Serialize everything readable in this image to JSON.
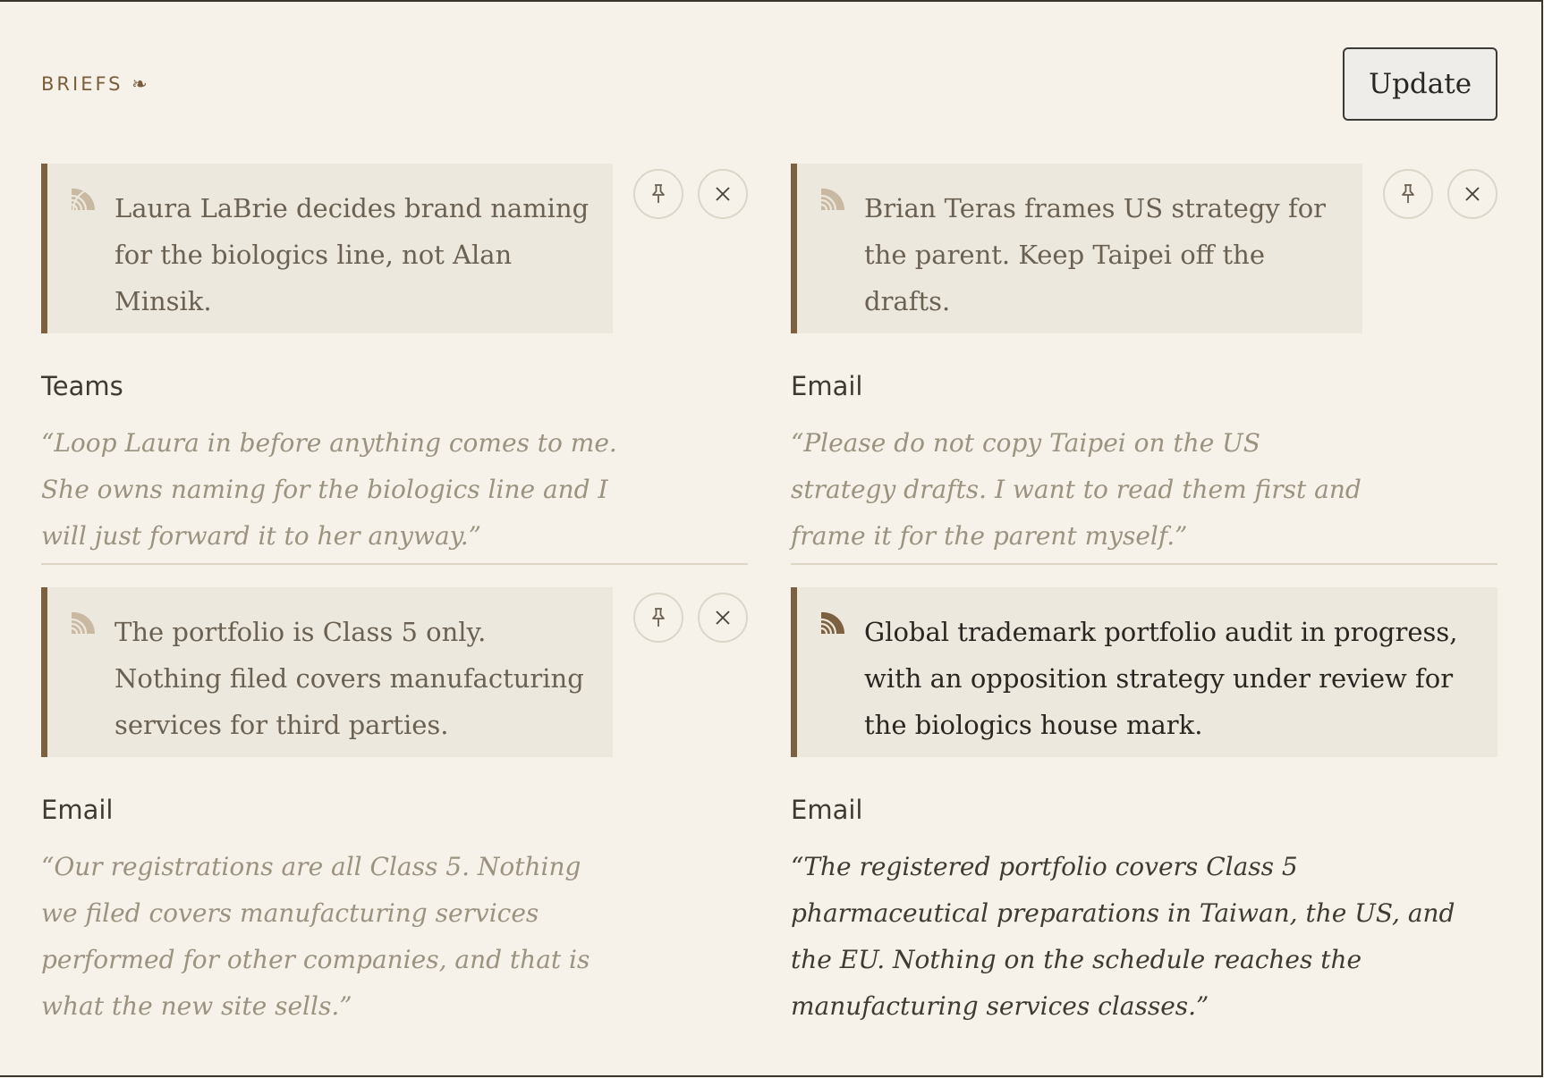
{
  "header": {
    "label": "BRIEFS ❧",
    "update_label": "Update"
  },
  "cards": [
    {
      "brief": "Laura LaBrie decides brand naming for the biologics line, not Alan Minsik.",
      "source": "Teams",
      "quote": "“Loop Laura in before anything comes to me. She owns naming for the biologics line and I will just forward it to her anyway.”"
    },
    {
      "brief": "Brian Teras frames US strategy for the parent. Keep Taipei off the drafts.",
      "source": "Email",
      "quote": "“Please do not copy Taipei on the US strategy drafts. I want to read them first and frame it for the parent myself.”"
    },
    {
      "brief": "The portfolio is Class 5 only. Nothing filed covers manufacturing services for third parties.",
      "source": "Email",
      "quote": "“Our registrations are all Class 5. Nothing we filed covers manufacturing services performed for other companies, and that is what the new site sells.”"
    },
    {
      "brief": "Global trademark portfolio audit in progress, with an opposition strategy under review for the biologics house mark.",
      "source": "Email",
      "quote": "“The registered portfolio covers Class 5 pharmaceutical preparations in Taiwan, the US, and the EU. Nothing on the schedule reaches the manufacturing services classes.”"
    }
  ],
  "icons": {
    "pin": "pin-icon",
    "close": "close-icon",
    "brief": "stacked-arc-icon"
  },
  "colors": {
    "accent": "#7d6040",
    "background": "#f6f2ea",
    "brief_bg": "#ede8de"
  }
}
